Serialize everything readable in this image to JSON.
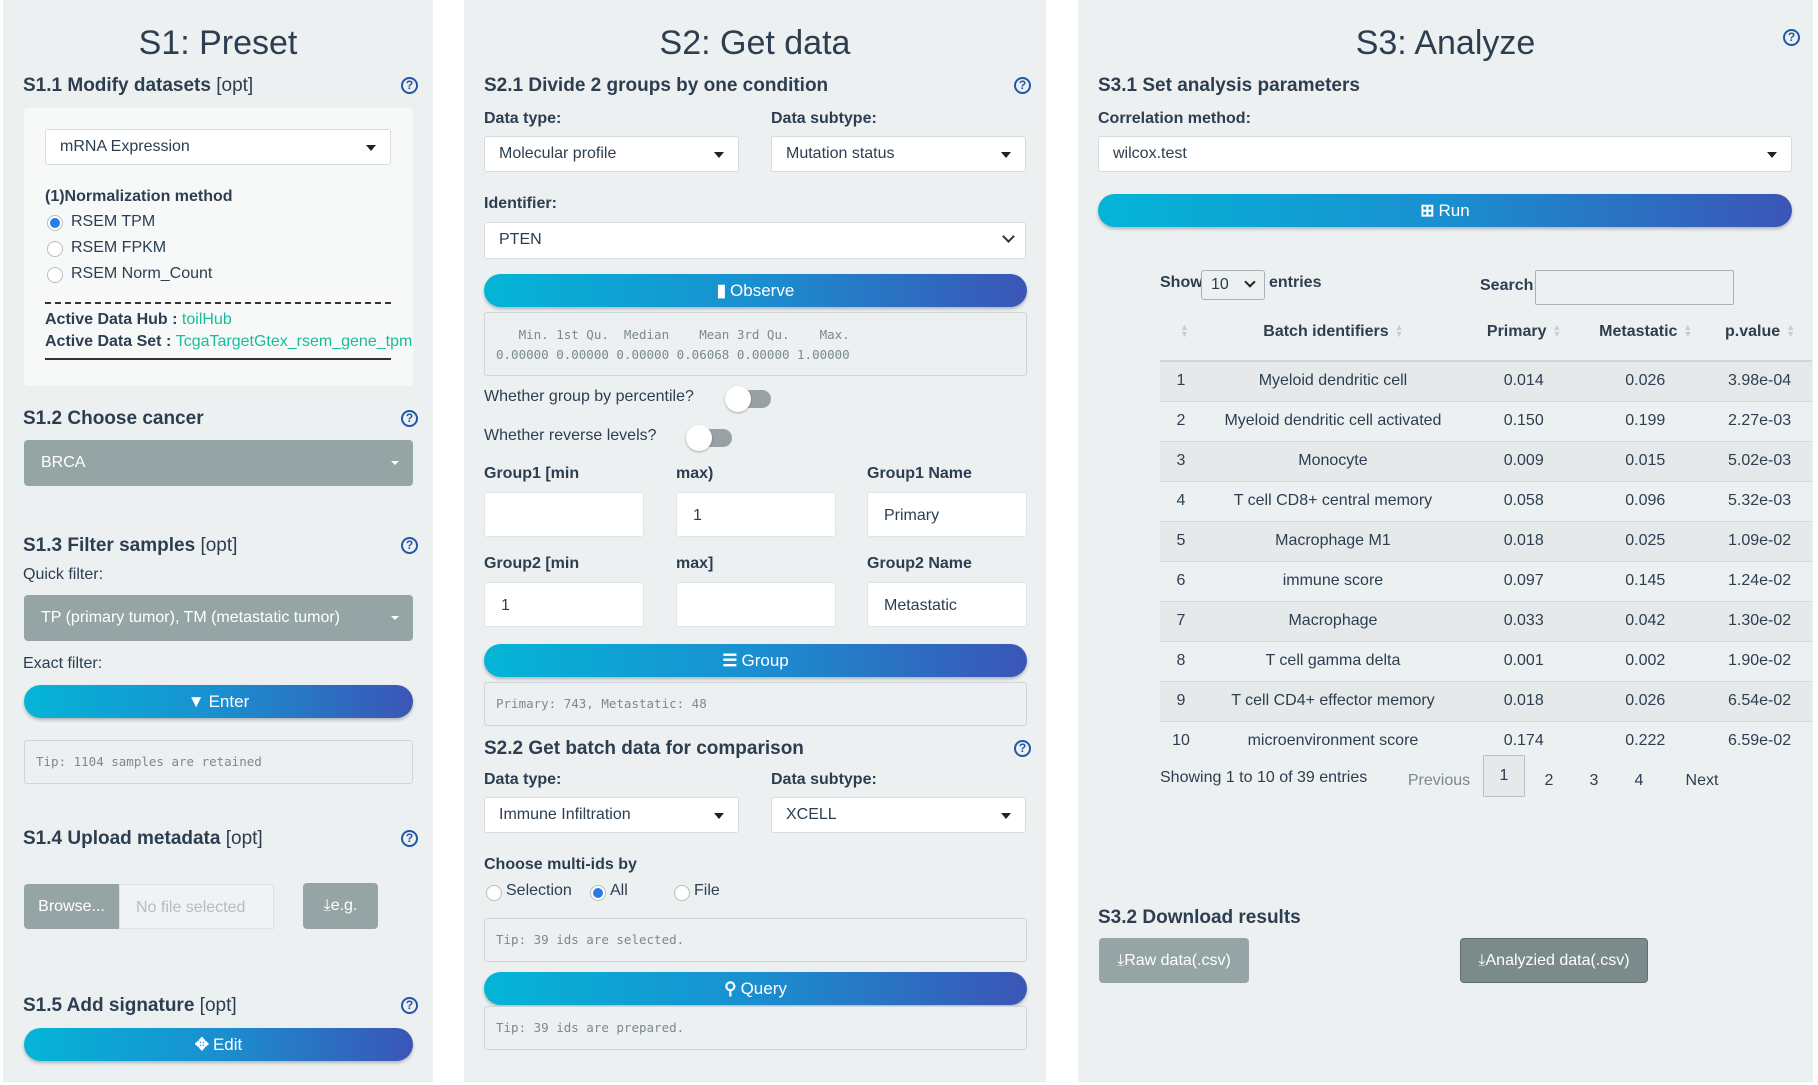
{
  "s1": {
    "title": "S1: Preset",
    "modify": {
      "heading": "S1.1 Modify datasets",
      "opt": "[opt]",
      "dataset_select": "mRNA Expression",
      "norm_label": "(1)Normalization method",
      "norm_options": [
        {
          "label": "RSEM TPM",
          "selected": true
        },
        {
          "label": "RSEM FPKM",
          "selected": false
        },
        {
          "label": "RSEM Norm_Count",
          "selected": false
        }
      ],
      "hub_label": "Active Data Hub : ",
      "hub_value": "toilHub",
      "set_label": "Active Data Set : ",
      "set_value": "TcgaTargetGtex_rsem_gene_tpm"
    },
    "cancer": {
      "heading": "S1.2 Choose cancer",
      "value": "BRCA"
    },
    "filter": {
      "heading": "S1.3 Filter samples",
      "opt": "[opt]",
      "quick_label": "Quick filter:",
      "quick_value": "TP (primary tumor), TM (metastatic tumor)",
      "exact_label": "Exact filter:",
      "enter_button": "Enter",
      "tip": "Tip: 1104 samples are retained"
    },
    "upload": {
      "heading": "S1.4 Upload metadata",
      "opt": "[opt]",
      "browse_button": "Browse...",
      "file_placeholder": "No file selected",
      "example_button": "e.g."
    },
    "signature": {
      "heading": "S1.5 Add signature",
      "opt": "[opt]",
      "edit_button": "Edit"
    }
  },
  "s2": {
    "title": "S2: Get data",
    "divide": {
      "heading": "S2.1 Divide 2 groups by one condition",
      "data_type_label": "Data type:",
      "data_type_value": "Molecular profile",
      "data_subtype_label": "Data subtype:",
      "data_subtype_value": "Mutation status",
      "identifier_label": "Identifier:",
      "identifier_value": "PTEN",
      "observe_button": "Observe",
      "summary_header": "   Min. 1st Qu.  Median    Mean 3rd Qu.    Max.",
      "summary_values": "0.00000 0.00000 0.00000 0.06068 0.00000 1.00000",
      "percentile_label": "Whether group by percentile?",
      "percentile_on": false,
      "reverse_label": "Whether reverse levels?",
      "reverse_on": false,
      "group1_min_label": "Group1 [min",
      "group1_max_label": "max)",
      "group1_name_label": "Group1 Name",
      "group1_min": "",
      "group1_max": "1",
      "group1_name": "Primary",
      "group2_min_label": "Group2 [min",
      "group2_max_label": "max]",
      "group2_name_label": "Group2 Name",
      "group2_min": "1",
      "group2_max": "",
      "group2_name": "Metastatic",
      "group_button": "Group",
      "group_result": "Primary: 743, Metastatic: 48"
    },
    "batch": {
      "heading": "S2.2 Get batch data for comparison",
      "data_type_label": "Data type:",
      "data_type_value": "Immune Infiltration",
      "data_subtype_label": "Data subtype:",
      "data_subtype_value": "XCELL",
      "choose_label": "Choose multi-ids by",
      "choose_options": [
        {
          "label": "Selection",
          "selected": false
        },
        {
          "label": "All",
          "selected": true
        },
        {
          "label": "File",
          "selected": false
        }
      ],
      "tip_selected": "Tip: 39 ids are selected.",
      "query_button": "Query",
      "tip_prepared": "Tip: 39 ids are prepared."
    }
  },
  "s3": {
    "title": "S3: Analyze",
    "params": {
      "heading": "S3.1 Set analysis parameters",
      "method_label": "Correlation method:",
      "method_value": "wilcox.test",
      "run_button": "Run"
    },
    "table": {
      "show_label": "Show",
      "show_value": "10",
      "entries_label": "entries",
      "search_label": "Search:",
      "search_value": "",
      "columns": [
        "",
        "Batch identifiers",
        "Primary",
        "Metastatic",
        "p.value"
      ],
      "rows": [
        [
          "1",
          "Myeloid dendritic cell",
          "0.014",
          "0.026",
          "3.98e-04"
        ],
        [
          "2",
          "Myeloid dendritic cell activated",
          "0.150",
          "0.199",
          "2.27e-03"
        ],
        [
          "3",
          "Monocyte",
          "0.009",
          "0.015",
          "5.02e-03"
        ],
        [
          "4",
          "T cell CD8+ central memory",
          "0.058",
          "0.096",
          "5.32e-03"
        ],
        [
          "5",
          "Macrophage M1",
          "0.018",
          "0.025",
          "1.09e-02"
        ],
        [
          "6",
          "immune score",
          "0.097",
          "0.145",
          "1.24e-02"
        ],
        [
          "7",
          "Macrophage",
          "0.033",
          "0.042",
          "1.30e-02"
        ],
        [
          "8",
          "T cell gamma delta",
          "0.001",
          "0.002",
          "1.90e-02"
        ],
        [
          "9",
          "T cell CD4+ effector memory",
          "0.018",
          "0.026",
          "6.54e-02"
        ],
        [
          "10",
          "microenvironment score",
          "0.174",
          "0.222",
          "6.59e-02"
        ]
      ],
      "info": "Showing 1 to 10 of 39 entries",
      "pagination": {
        "previous": "Previous",
        "pages": [
          "1",
          "2",
          "3",
          "4"
        ],
        "current": "1",
        "next": "Next"
      }
    },
    "download": {
      "heading": "S3.2 Download results",
      "raw_button": "Raw data(.csv)",
      "analyzed_button": "Analyzied data(.csv)"
    }
  },
  "colors": {
    "panel_bg": "#ecf0f1",
    "text": "#2c3e50",
    "link": "#18bc9c",
    "help_icon": "#2257a8",
    "button_gradient_start": "#04b5d6",
    "button_gradient_end": "#3b55b7",
    "grey_button": "#95a5a6",
    "dark_button": "#7b8a8b"
  }
}
